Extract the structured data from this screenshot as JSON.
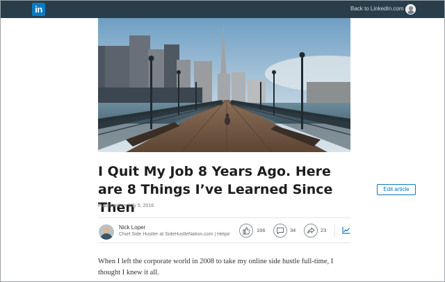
{
  "topbar": {
    "logo_text": "in",
    "back_link": "Back to LinkedIn.com"
  },
  "article": {
    "title": "I Quit My Job 8 Years Ago. Here are 8 Things I’ve Learned Since Then",
    "edit_label": "Edit article",
    "published": "Published on July 5, 2016",
    "body": "When I left the corporate world in 2008 to take my online side hustle full-time, I thought I knew it all."
  },
  "author": {
    "name": "Nick Loper",
    "headline": "Chief Side Hustler at SideHustleNation.com | Helping people build better side hustles"
  },
  "actions": {
    "likes": "166",
    "comments": "34",
    "shares": "23"
  },
  "colors": {
    "topbar": "#293e4a",
    "brand": "#0a7bc2"
  },
  "icons": [
    "linkedin-logo-icon",
    "like-icon",
    "comment-icon",
    "share-icon",
    "stats-icon"
  ]
}
